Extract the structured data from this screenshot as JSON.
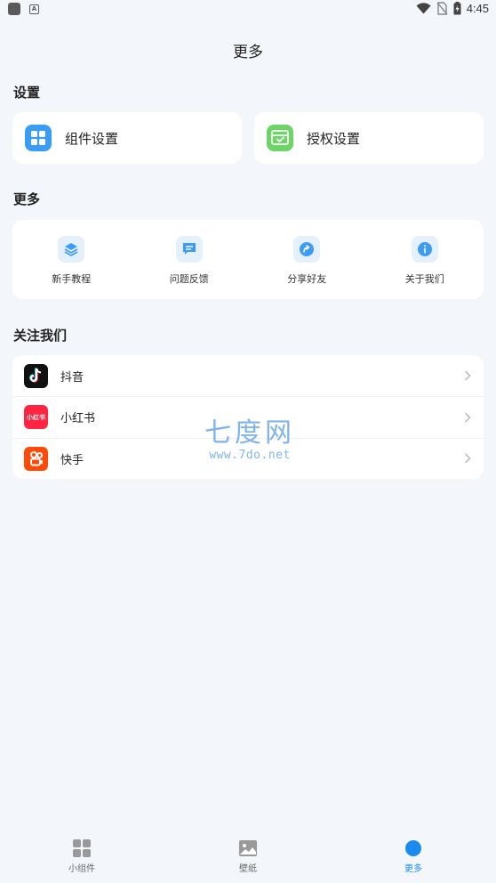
{
  "status_bar": {
    "time": "4:45",
    "icons": [
      "app-square-icon",
      "a-badge-icon",
      "wifi-icon",
      "no-sim-icon",
      "battery-charging-icon"
    ]
  },
  "header": {
    "title": "更多"
  },
  "settings": {
    "title": "设置",
    "items": [
      {
        "label": "组件设置",
        "icon": "widget-grid-icon",
        "color": "#3b9cf5"
      },
      {
        "label": "授权设置",
        "icon": "authorize-check-icon",
        "color": "#6dd468"
      }
    ]
  },
  "more": {
    "title": "更多",
    "items": [
      {
        "label": "新手教程",
        "icon": "layers-icon"
      },
      {
        "label": "问题反馈",
        "icon": "chat-icon"
      },
      {
        "label": "分享好友",
        "icon": "share-arrow-icon"
      },
      {
        "label": "关于我们",
        "icon": "info-icon"
      }
    ],
    "icon_bg": "#e4f0fb",
    "icon_fg": "#3e9bf2"
  },
  "follow": {
    "title": "关注我们",
    "items": [
      {
        "label": "抖音",
        "icon": "douyin-icon"
      },
      {
        "label": "小红书",
        "icon": "xiaohongshu-icon",
        "icon_text": "小红书"
      },
      {
        "label": "快手",
        "icon": "kuaishou-icon"
      }
    ]
  },
  "watermark": {
    "main": "七度网",
    "sub": "www.7do.net"
  },
  "bottom_nav": {
    "items": [
      {
        "label": "小组件",
        "icon": "widgets-icon",
        "active": false
      },
      {
        "label": "壁纸",
        "icon": "image-icon",
        "active": false
      },
      {
        "label": "更多",
        "icon": "more-dot-icon",
        "active": true
      }
    ],
    "active_color": "#1c8bf0"
  }
}
